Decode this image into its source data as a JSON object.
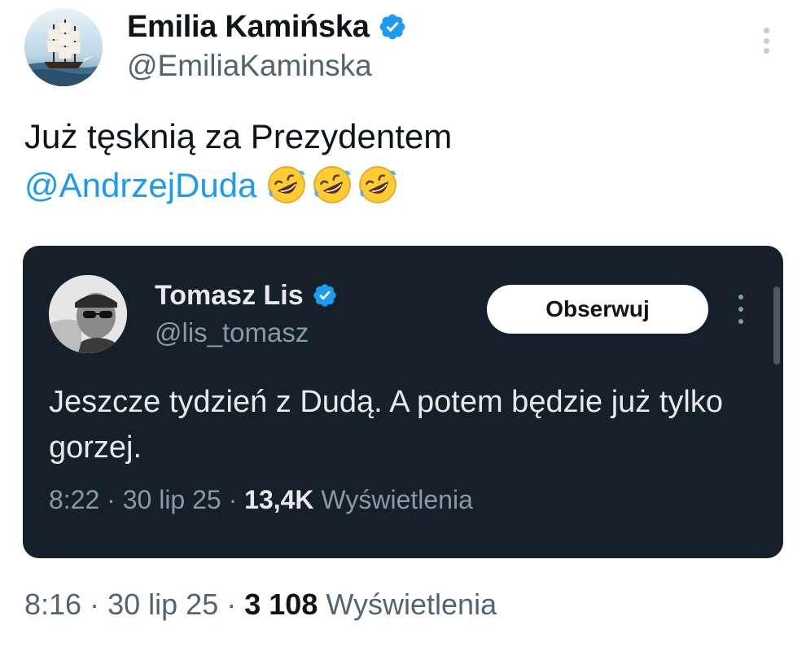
{
  "tweet": {
    "author": {
      "display_name": "Emilia Kamińska",
      "handle": "@EmiliaKaminska",
      "verified": true,
      "avatar_icon": "sailing-ship-icon"
    },
    "text_line_1": "Już tęsknią za Prezydentem",
    "mention": "@AndrzejDuda",
    "emoji_icons": [
      "rolling-on-floor-laughing-icon",
      "rolling-on-floor-laughing-icon",
      "rolling-on-floor-laughing-icon"
    ],
    "meta": {
      "time": "8:16",
      "separator": "·",
      "date": "30 lip 25",
      "views_count": "3 108",
      "views_label": "Wyświetlenia"
    },
    "more_icon": "more-vertical-icon"
  },
  "quoted_tweet": {
    "author": {
      "display_name": "Tomasz Lis",
      "handle": "@lis_tomasz",
      "verified": true,
      "avatar_icon": "person-with-sunglasses-icon"
    },
    "follow_label": "Obserwuj",
    "text": "Jeszcze tydzień z Dudą. A potem będzie już tylko gorzej.",
    "meta": {
      "time": "8:22",
      "separator": "·",
      "date": "30 lip 25",
      "views_count": "13,4K",
      "views_label": "Wyświetlenia"
    },
    "more_icon": "more-vertical-icon"
  },
  "colors": {
    "accent": "#1d9bf0",
    "quote_background": "#15202b",
    "muted_text": "#536471"
  }
}
